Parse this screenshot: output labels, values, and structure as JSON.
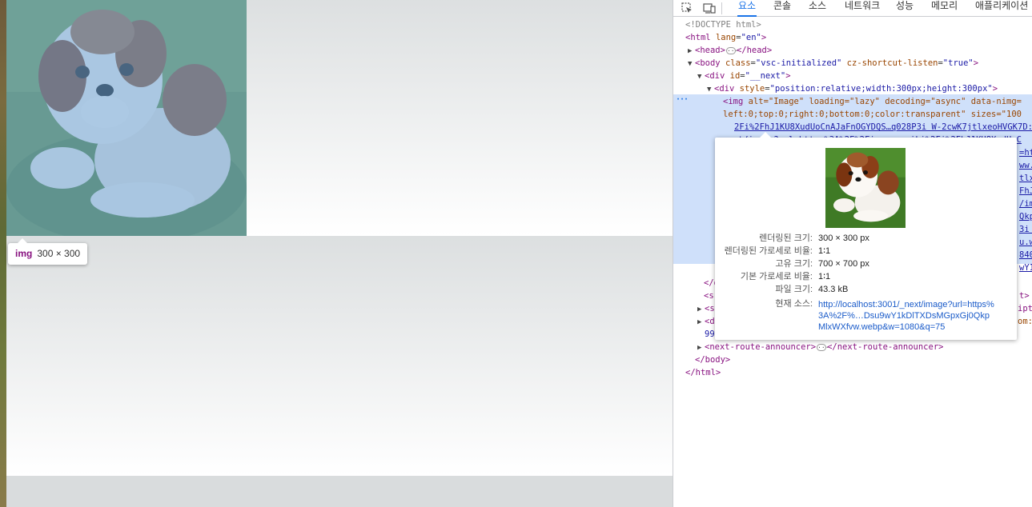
{
  "overlay": {
    "tooltip_tag": "img",
    "tooltip_size": "300 × 300"
  },
  "devtools": {
    "tabs": [
      "요소",
      "콘솔",
      "소스",
      "네트워크",
      "성능",
      "메모리",
      "애플리케이션"
    ],
    "active_tab": "요소",
    "tree": {
      "doctype": "<!DOCTYPE html>",
      "html_open_tag": "<html",
      "html_lang_attr": "lang",
      "html_lang_value": "\"en\"",
      "head_open": "<head>",
      "head_close": "</head>",
      "body_tag": "<body",
      "body_class_attr": "class",
      "body_class_value": "\"vsc-initialized\"",
      "body_cz_attr": "cz-shortcut-listen",
      "body_cz_value": "\"true\"",
      "div_next_tag": "<div",
      "div_next_attr": "id",
      "div_next_value": "\"__next\"",
      "div_style_tag": "<div",
      "div_style_attr": "style",
      "div_style_value": "\"position:relative;width:300px;height:300px\"",
      "img_tag": "<img",
      "img_attrs_line1": "alt=\"Image\" loading=\"lazy\" decoding=\"async\" data-nimg=",
      "img_line2": "left:0;top:0;right:0;bottom:0;color:transparent\" sizes=\"100",
      "img_line3_link": "2Fi%2FhJ1KU8XudUoCnAJaFnOGYDQS…q028P3i W-2cwK7jtlxeoHVGK7D:",
      "img_line4_link": "next/image?url=https%3A%2F%2Fi.namu.wiki%2Fi%2FhJ1KU8XudUoC",
      "img_frag_lines": [
        "=htt",
        "ww.w",
        "tlxe",
        "FhJ1",
        "/ima",
        "QkpM",
        "3i W",
        "u.wi",
        "840w",
        "wY1k"
      ],
      "div_close": "</div>",
      "script_frag_left": "<s",
      "script_frag_right": "t>",
      "script2_frag_left": "<s",
      "script2_frag_right": "ipt",
      "d_frag_left": "<d",
      "d_frag_right": "om:",
      "num_frag": "99",
      "route_open": "<next-route-announcer>",
      "route_close": "</next-route-announcer>",
      "body_close": "</body>",
      "html_close": "</html>"
    },
    "popover": {
      "rendered_size_label": "렌더링된 크기:",
      "rendered_size_value": "300 × 300 px",
      "rendered_ratio_label": "렌더링된 가로세로 비율:",
      "rendered_ratio_value": "1∶1",
      "intrinsic_size_label": "고유 크기:",
      "intrinsic_size_value": "700 × 700 px",
      "intrinsic_ratio_label": "기본 가로세로 비율:",
      "intrinsic_ratio_value": "1∶1",
      "file_size_label": "파일 크기:",
      "file_size_value": "43.3 kB",
      "current_source_label": "현재 소스:",
      "current_source_value": "http://localhost:3001/_next/image?url=https%3A%2F%…Dsu9wY1kDlTXDsMGpxGj0QkpMlxWXfvw.webp&w=1080&q=75"
    }
  }
}
